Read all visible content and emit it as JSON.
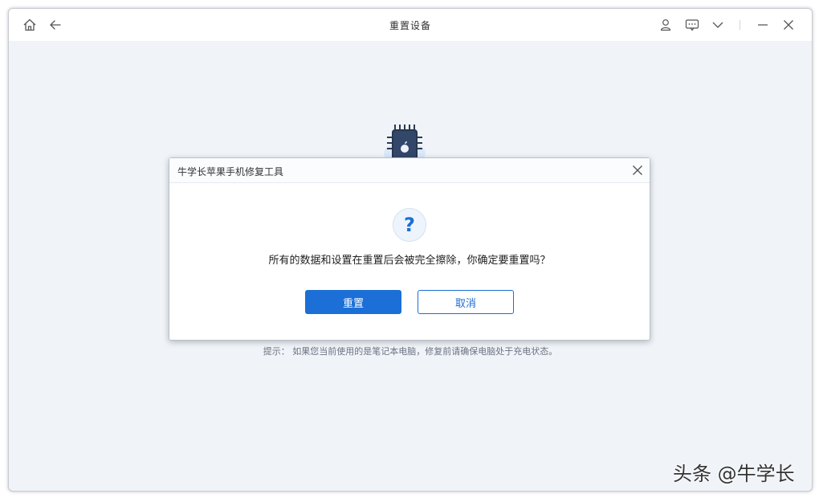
{
  "window": {
    "title": "重置设备"
  },
  "titlebar": {
    "icons": [
      "home-icon",
      "back-arrow-icon",
      "user-icon",
      "feedback-icon",
      "chevron-down-icon",
      "minimize-icon",
      "close-icon"
    ]
  },
  "page": {
    "hint": "提示：  如果您当前使用的是笔记本电脑，修复前请确保电脑处于充电状态。"
  },
  "dialog": {
    "title": "牛学长苹果手机修复工具",
    "message": "所有的数据和设置在重置后会被完全擦除，你确定要重置吗？",
    "question_mark": "?",
    "confirm_label": "重置",
    "cancel_label": "取消"
  },
  "watermark": "头条 @牛学长",
  "colors": {
    "accent": "#1b6fd6",
    "background": "#f0f4f9"
  }
}
